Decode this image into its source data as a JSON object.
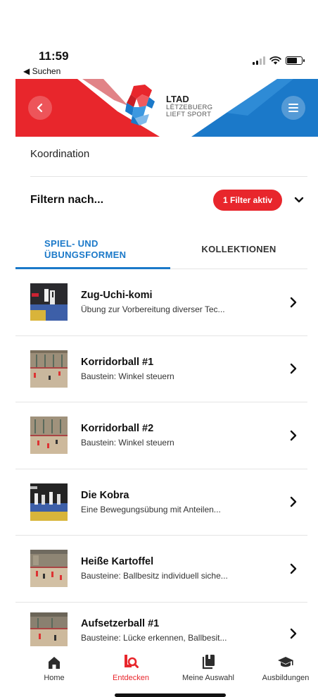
{
  "status_bar": {
    "time": "11:59",
    "back_app": "◀ Suchen"
  },
  "header": {
    "logo_title": "LTAD",
    "logo_line2": "LËTZEBUERG",
    "logo_line3": "LIEFT SPORT",
    "colors": {
      "red": "#e8262c",
      "blue": "#1b79c9"
    }
  },
  "breadcrumb": "Koordination",
  "filter": {
    "label": "Filtern nach...",
    "badge": "1 Filter aktiv"
  },
  "tabs": [
    {
      "label": "SPIEL- UND ÜBUNGSFORMEN",
      "active": true
    },
    {
      "label": "KOLLEKTIONEN",
      "active": false
    }
  ],
  "items": [
    {
      "title": "Zug-Uchi-komi",
      "subtitle": "Übung zur Vorbereitung diverser Tec..."
    },
    {
      "title": "Korridorball #1",
      "subtitle": "Baustein: Winkel steuern"
    },
    {
      "title": "Korridorball #2",
      "subtitle": "Baustein: Winkel steuern"
    },
    {
      "title": "Die Kobra",
      "subtitle": "Eine Bewegungsübung mit Anteilen..."
    },
    {
      "title": "Heiße Kartoffel",
      "subtitle": "Bausteine: Ballbesitz individuell siche..."
    },
    {
      "title": "Aufsetzerball #1",
      "subtitle": "Bausteine: Lücke erkennen, Ballbesit..."
    }
  ],
  "tabbar": {
    "home": "Home",
    "discover": "Entdecken",
    "selection": "Meine Auswahl",
    "education": "Ausbildungen",
    "active_color": "#e8262c"
  }
}
